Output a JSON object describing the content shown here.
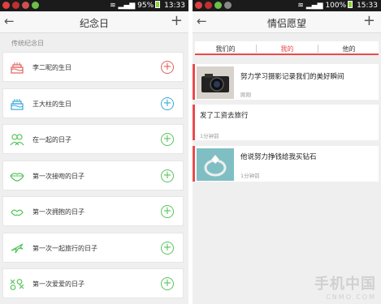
{
  "left": {
    "status": {
      "battery": "95%",
      "time": "13:33"
    },
    "title": "纪念日",
    "back_glyph": "←",
    "add_glyph": "+",
    "section_label": "传统纪念日",
    "items": [
      {
        "label": "李二昵的生日",
        "icon": "cake-icon",
        "color": "#e0605c"
      },
      {
        "label": "王大柱的生日",
        "icon": "cake-icon",
        "color": "#3ba8d8"
      },
      {
        "label": "在一起的日子",
        "icon": "couple-icon",
        "color": "#58c45c"
      },
      {
        "label": "第一次接吻的日子",
        "icon": "lips-icon",
        "color": "#58c45c"
      },
      {
        "label": "第一次拥抱的日子",
        "icon": "hug-icon",
        "color": "#58c45c"
      },
      {
        "label": "第一次一起旅行的日子",
        "icon": "plane-icon",
        "color": "#58c45c"
      },
      {
        "label": "第一次爱爱的日子",
        "icon": "xo-icon",
        "color": "#58c45c"
      }
    ]
  },
  "right": {
    "status": {
      "battery": "100%",
      "time": "15:33"
    },
    "title": "情侣愿望",
    "back_glyph": "←",
    "add_glyph": "+",
    "tabs": [
      "我们的",
      "我的",
      "他的"
    ],
    "active_tab": 1,
    "wishes": [
      {
        "text": "努力学习摄影记录我们的美好瞬间",
        "time": "刚刚",
        "image": "camera-image"
      },
      {
        "text": "发了工资去旅行",
        "time": "1分钟前",
        "image": ""
      },
      {
        "text": "他说努力挣钱给我买钻石",
        "time": "1分钟前",
        "image": "ring-image"
      }
    ],
    "watermark": {
      "line1": "手机中国",
      "line2": "CNMO.COM"
    }
  },
  "colors": {
    "accent": "#e84b4b",
    "green": "#58c45c",
    "red": "#e0605c",
    "blue": "#3ba8d8"
  }
}
